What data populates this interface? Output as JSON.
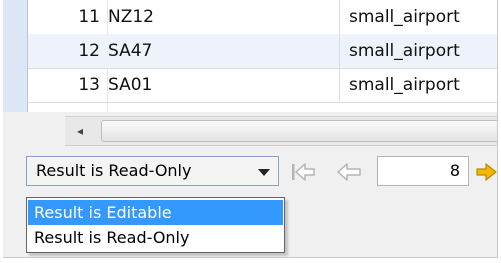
{
  "grid": {
    "rows": [
      {
        "num": "11",
        "code": "NZ12",
        "type": "small_airport"
      },
      {
        "num": "12",
        "code": "SA47",
        "type": "small_airport"
      },
      {
        "num": "13",
        "code": "SA01",
        "type": "small_airport"
      }
    ]
  },
  "scrollbar": {
    "left_arrow": "◂"
  },
  "toolbar": {
    "mode_select_value": "Result is Read-Only",
    "page_number": "8",
    "dropdown_options": [
      "Result is Editable",
      "Result is Read-Only"
    ],
    "highlighted_option": "Result is Editable"
  },
  "colors": {
    "selection": "#3399ff",
    "row_alt": "#eef3fb",
    "nav_next": "#f2b800"
  }
}
